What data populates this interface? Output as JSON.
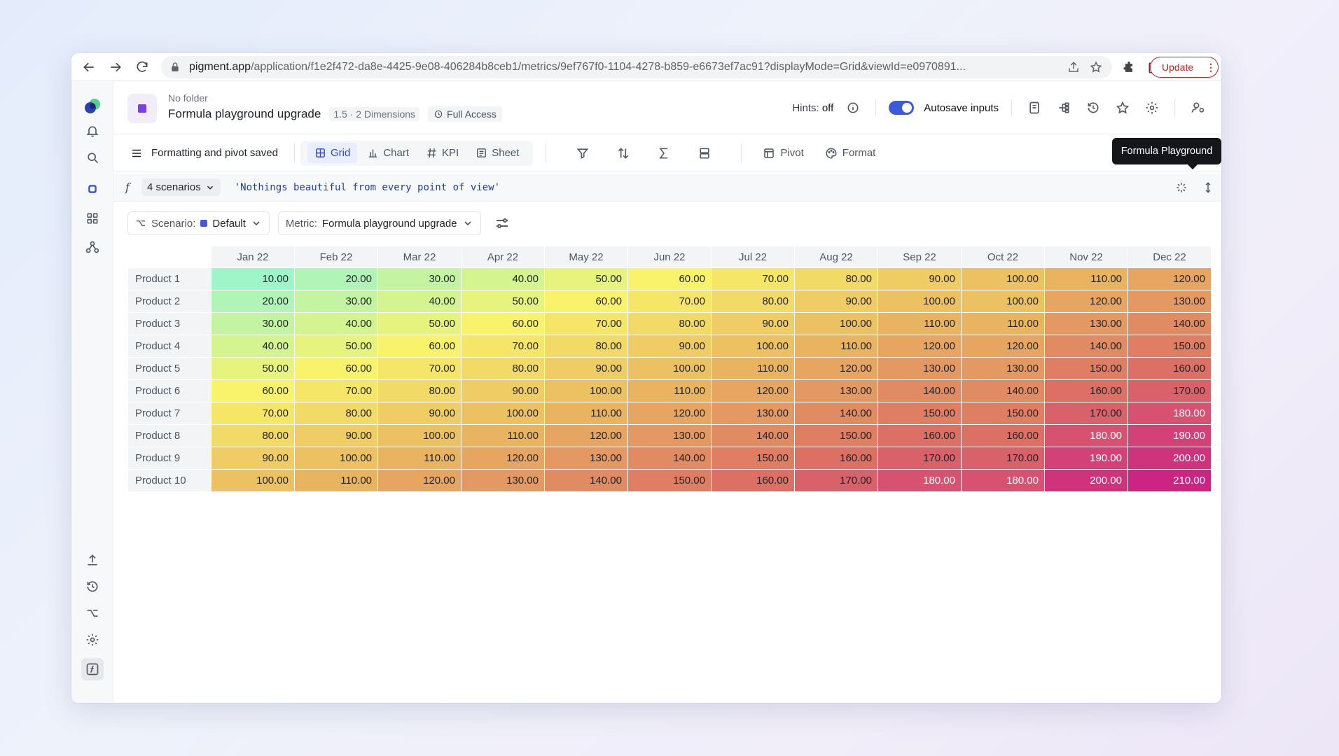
{
  "browser": {
    "url_host": "pigment.app",
    "url_path": "/application/f1e2f472-da8e-4425-9e08-406284b8ceb1/metrics/9ef767f0-1104-4278-b859-e6673ef7ac91?displayMode=Grid&viewId=e0970891...",
    "update_label": "Update"
  },
  "header": {
    "folder": "No folder",
    "title": "Formula playground upgrade",
    "version": "1.5 · 2 Dimensions",
    "access": "Full Access",
    "hints_label": "Hints:",
    "hints_value": "off",
    "autosave_label": "Autosave inputs"
  },
  "toolbar": {
    "saved_label": "Formatting and pivot saved",
    "views": [
      {
        "label": "Grid",
        "icon": "grid-icon"
      },
      {
        "label": "Chart",
        "icon": "bar-chart-icon"
      },
      {
        "label": "KPI",
        "icon": "hash-icon"
      },
      {
        "label": "Sheet",
        "icon": "sheet-icon"
      }
    ],
    "pivot_label": "Pivot",
    "format_label": "Format",
    "tooltip": "Formula Playground"
  },
  "formula_bar": {
    "scenarios_label": "4 scenarios",
    "formula": "'Nothings beautiful from every point of view'"
  },
  "filters": {
    "scenario_label": "Scenario:",
    "scenario_value": "Default",
    "metric_label": "Metric:",
    "metric_value": "Formula playground upgrade"
  },
  "table": {
    "columns": [
      "Jan 22",
      "Feb 22",
      "Mar 22",
      "Apr 22",
      "May 22",
      "Jun 22",
      "Jul 22",
      "Aug 22",
      "Sep 22",
      "Oct 22",
      "Nov 22",
      "Dec 22"
    ],
    "rows": [
      {
        "label": "Product 1",
        "values": [
          "10.00",
          "20.00",
          "30.00",
          "40.00",
          "50.00",
          "60.00",
          "70.00",
          "80.00",
          "90.00",
          "100.00",
          "110.00",
          "120.00"
        ]
      },
      {
        "label": "Product 2",
        "values": [
          "20.00",
          "30.00",
          "40.00",
          "50.00",
          "60.00",
          "70.00",
          "80.00",
          "90.00",
          "100.00",
          "100.00",
          "120.00",
          "130.00"
        ]
      },
      {
        "label": "Product 3",
        "values": [
          "30.00",
          "40.00",
          "50.00",
          "60.00",
          "70.00",
          "80.00",
          "90.00",
          "100.00",
          "110.00",
          "110.00",
          "130.00",
          "140.00"
        ]
      },
      {
        "label": "Product 4",
        "values": [
          "40.00",
          "50.00",
          "60.00",
          "70.00",
          "80.00",
          "90.00",
          "100.00",
          "110.00",
          "120.00",
          "120.00",
          "140.00",
          "150.00"
        ]
      },
      {
        "label": "Product 5",
        "values": [
          "50.00",
          "60.00",
          "70.00",
          "80.00",
          "90.00",
          "100.00",
          "110.00",
          "120.00",
          "130.00",
          "130.00",
          "150.00",
          "160.00"
        ]
      },
      {
        "label": "Product 6",
        "values": [
          "60.00",
          "70.00",
          "80.00",
          "90.00",
          "100.00",
          "110.00",
          "120.00",
          "130.00",
          "140.00",
          "140.00",
          "160.00",
          "170.00"
        ]
      },
      {
        "label": "Product 7",
        "values": [
          "70.00",
          "80.00",
          "90.00",
          "100.00",
          "110.00",
          "120.00",
          "130.00",
          "140.00",
          "150.00",
          "150.00",
          "170.00",
          "180.00"
        ]
      },
      {
        "label": "Product 8",
        "values": [
          "80.00",
          "90.00",
          "100.00",
          "110.00",
          "120.00",
          "130.00",
          "140.00",
          "150.00",
          "160.00",
          "160.00",
          "180.00",
          "190.00"
        ]
      },
      {
        "label": "Product 9",
        "values": [
          "90.00",
          "100.00",
          "110.00",
          "120.00",
          "130.00",
          "140.00",
          "150.00",
          "160.00",
          "170.00",
          "170.00",
          "190.00",
          "200.00"
        ]
      },
      {
        "label": "Product 10",
        "values": [
          "100.00",
          "110.00",
          "120.00",
          "130.00",
          "140.00",
          "150.00",
          "160.00",
          "170.00",
          "180.00",
          "180.00",
          "200.00",
          "210.00"
        ]
      }
    ],
    "heat_scale": {
      "min": 10,
      "max": 210,
      "colors": [
        "#9ef5c8",
        "#f8f36a",
        "#e9b460",
        "#dc7064",
        "#cc2482"
      ]
    }
  },
  "colors": {
    "accent": "#3b5bdb",
    "update_red": "#c5221f"
  }
}
